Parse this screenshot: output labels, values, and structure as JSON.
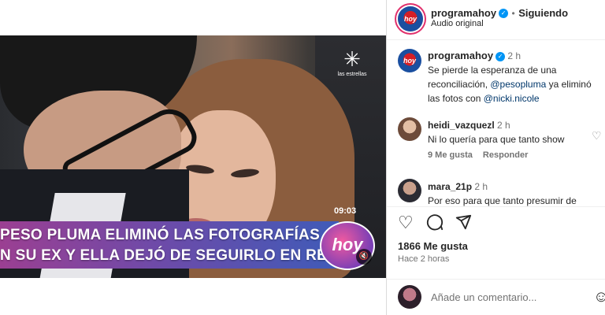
{
  "video": {
    "channel_logo_text": "las estrellas",
    "timecode": "09:03",
    "headline_line1": "PESO PLUMA ELIMINÓ LAS FOTOGRAFÍAS",
    "headline_line2": "N SU EX Y ELLA DEJÓ DE SEGUIRLO EN REDES",
    "badge_text": "hoy"
  },
  "header": {
    "username": "programahoy",
    "separator": "•",
    "follow_status": "Siguiendo",
    "audio": "Audio original"
  },
  "caption": {
    "username": "programahoy",
    "time": "2 h",
    "text_part1": "Se pierde la esperanza de una reconciliación, ",
    "mention1": "@pesopluma",
    "text_part2": " ya eliminó las fotos con ",
    "mention2": "@nicki.nicole"
  },
  "comments": [
    {
      "username": "heidi_vazquezl",
      "time": "2 h",
      "text": "Ni lo quería para que tanto show",
      "likes": "9 Me gusta",
      "reply": "Responder"
    },
    {
      "username": "mara_21p",
      "time": "2 h",
      "text": "Por eso para que tanto presumir de"
    }
  ],
  "actions": {
    "likes": "1866 Me gusta",
    "posted": "Hace 2 horas"
  },
  "add_comment": {
    "placeholder": "Añade un comentario..."
  },
  "icons": {
    "heart": "heart-icon",
    "comment": "comment-icon",
    "share": "share-icon",
    "emoji": "emoji-icon"
  },
  "colors": {
    "verified": "#0095f6",
    "link": "#00376b",
    "banner_start": "#9b3f92",
    "banner_end": "#3f5bb8"
  }
}
